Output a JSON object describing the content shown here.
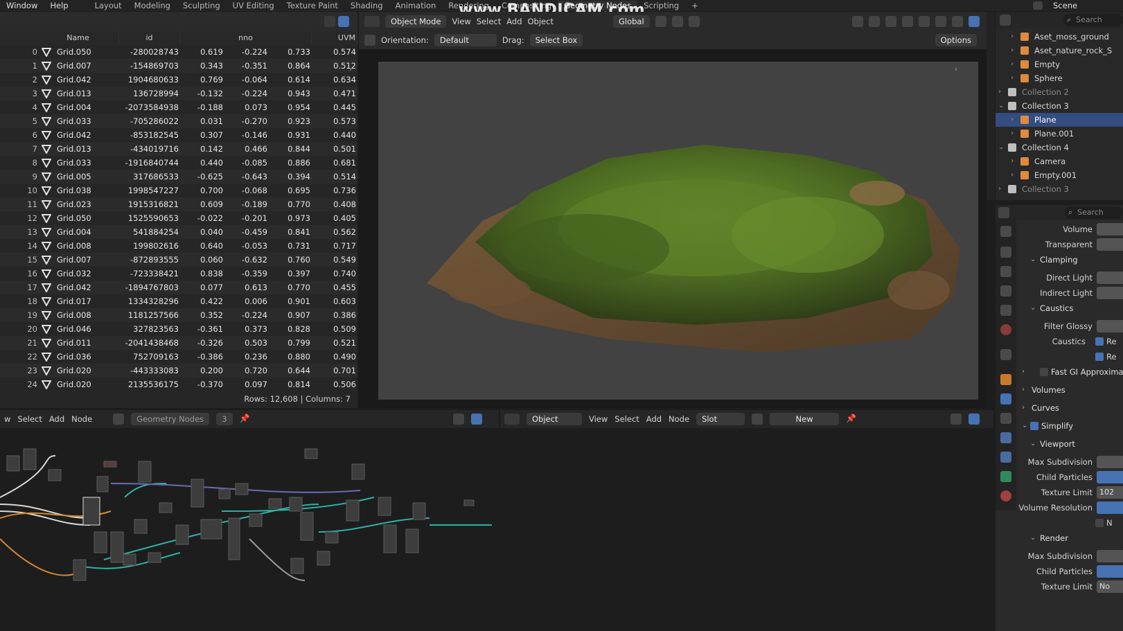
{
  "menu": [
    "Window",
    "Help"
  ],
  "workspaces": [
    {
      "label": "Layout",
      "active": false
    },
    {
      "label": "Modeling",
      "active": false
    },
    {
      "label": "Sculpting",
      "active": false
    },
    {
      "label": "UV Editing",
      "active": false
    },
    {
      "label": "Texture Paint",
      "active": false
    },
    {
      "label": "Shading",
      "active": false
    },
    {
      "label": "Animation",
      "active": false
    },
    {
      "label": "Rendering",
      "active": false
    },
    {
      "label": "Compositing",
      "active": false
    },
    {
      "label": "Geometry Nodes",
      "active": true
    },
    {
      "label": "Scripting",
      "active": false
    }
  ],
  "add_workspace": "+",
  "watermark": "www.BANDICAM.com",
  "scene_label": "Scene",
  "spreadsheet": {
    "columns": [
      "Name",
      "id",
      "nno",
      "UVM"
    ],
    "rows": [
      [
        "0",
        "Grid.050",
        "-280028743",
        "0.619",
        "-0.224",
        "0.733",
        "0.574"
      ],
      [
        "1",
        "Grid.007",
        "-154869703",
        "0.343",
        "-0.351",
        "0.864",
        "0.512"
      ],
      [
        "2",
        "Grid.042",
        "1904680633",
        "0.769",
        "-0.064",
        "0.614",
        "0.634"
      ],
      [
        "3",
        "Grid.013",
        "136728994",
        "-0.132",
        "-0.224",
        "0.943",
        "0.471"
      ],
      [
        "4",
        "Grid.004",
        "-2073584938",
        "-0.188",
        "0.073",
        "0.954",
        "0.445"
      ],
      [
        "5",
        "Grid.033",
        "-705286022",
        "0.031",
        "-0.270",
        "0.923",
        "0.573"
      ],
      [
        "6",
        "Grid.042",
        "-853182545",
        "0.307",
        "-0.146",
        "0.931",
        "0.440"
      ],
      [
        "7",
        "Grid.013",
        "-434019716",
        "0.142",
        "0.466",
        "0.844",
        "0.501"
      ],
      [
        "8",
        "Grid.033",
        "-1916840744",
        "0.440",
        "-0.085",
        "0.886",
        "0.681"
      ],
      [
        "9",
        "Grid.005",
        "317686533",
        "-0.625",
        "-0.643",
        "0.394",
        "0.514"
      ],
      [
        "10",
        "Grid.038",
        "1998547227",
        "0.700",
        "-0.068",
        "0.695",
        "0.736"
      ],
      [
        "11",
        "Grid.023",
        "1915316821",
        "0.609",
        "-0.189",
        "0.770",
        "0.408"
      ],
      [
        "12",
        "Grid.050",
        "1525590653",
        "-0.022",
        "-0.201",
        "0.973",
        "0.405"
      ],
      [
        "13",
        "Grid.004",
        "541884254",
        "0.040",
        "-0.459",
        "0.841",
        "0.562"
      ],
      [
        "14",
        "Grid.008",
        "199802616",
        "0.640",
        "-0.053",
        "0.731",
        "0.717"
      ],
      [
        "15",
        "Grid.007",
        "-872893555",
        "0.060",
        "-0.632",
        "0.760",
        "0.549"
      ],
      [
        "16",
        "Grid.032",
        "-723338421",
        "0.838",
        "-0.359",
        "0.397",
        "0.740"
      ],
      [
        "17",
        "Grid.042",
        "-1894767803",
        "0.077",
        "0.613",
        "0.770",
        "0.455"
      ],
      [
        "18",
        "Grid.017",
        "1334328296",
        "0.422",
        "0.006",
        "0.901",
        "0.603"
      ],
      [
        "19",
        "Grid.008",
        "1181257566",
        "0.352",
        "-0.224",
        "0.907",
        "0.386"
      ],
      [
        "20",
        "Grid.046",
        "327823563",
        "-0.361",
        "0.373",
        "0.828",
        "0.509"
      ],
      [
        "21",
        "Grid.011",
        "-2041438468",
        "-0.326",
        "0.503",
        "0.799",
        "0.521"
      ],
      [
        "22",
        "Grid.036",
        "752709163",
        "-0.386",
        "0.236",
        "0.880",
        "0.490"
      ],
      [
        "23",
        "Grid.020",
        "-443333083",
        "0.200",
        "0.720",
        "0.644",
        "0.701"
      ],
      [
        "24",
        "Grid.020",
        "2135536175",
        "-0.370",
        "0.097",
        "0.814",
        "0.506"
      ]
    ],
    "footer": "Rows: 12,608   |   Columns: 7"
  },
  "viewport": {
    "mode": "Object Mode",
    "menus": [
      "View",
      "Select",
      "Add",
      "Object"
    ],
    "transform": "Global",
    "orientation_label": "Orientation:",
    "orientation_value": "Default",
    "drag_label": "Drag:",
    "drag_value": "Select Box",
    "options": "Options"
  },
  "outliner": {
    "search_placeholder": "Search",
    "items": [
      {
        "label": "Aset_moss_ground",
        "indent": 2,
        "icon": "mesh-icon",
        "selected": false
      },
      {
        "label": "Aset_nature_rock_S",
        "indent": 2,
        "icon": "mesh-icon",
        "selected": false
      },
      {
        "label": "Empty",
        "indent": 2,
        "icon": "empty-icon",
        "selected": false
      },
      {
        "label": "Sphere",
        "indent": 2,
        "icon": "mesh-icon",
        "selected": false
      },
      {
        "label": "Collection 2",
        "indent": 1,
        "icon": "collection-icon",
        "selected": false
      },
      {
        "label": "Collection 3",
        "indent": 1,
        "icon": "collection-icon",
        "selected": false
      },
      {
        "label": "Plane",
        "indent": 2,
        "icon": "mesh-icon",
        "selected": true
      },
      {
        "label": "Plane.001",
        "indent": 2,
        "icon": "mesh-icon",
        "selected": false
      },
      {
        "label": "Collection 4",
        "indent": 1,
        "icon": "collection-icon",
        "selected": false
      },
      {
        "label": "Camera",
        "indent": 2,
        "icon": "camera-icon",
        "selected": false
      },
      {
        "label": "Empty.001",
        "indent": 2,
        "icon": "empty-icon",
        "selected": false
      },
      {
        "label": "Collection 3",
        "indent": 1,
        "icon": "collection-icon",
        "selected": false
      }
    ]
  },
  "properties": {
    "search_placeholder": "Search",
    "rows": [
      {
        "type": "field",
        "label": "Volume"
      },
      {
        "type": "field",
        "label": "Transparent"
      },
      {
        "type": "section",
        "label": "Clamping"
      },
      {
        "type": "field",
        "label": "Direct Light"
      },
      {
        "type": "field",
        "label": "Indirect Light"
      },
      {
        "type": "section",
        "label": "Caustics"
      },
      {
        "type": "field",
        "label": "Filter Glossy"
      },
      {
        "type": "check",
        "label": "Caustics",
        "value": "Re"
      },
      {
        "type": "check",
        "label": "",
        "value": "Re"
      },
      {
        "type": "section",
        "label": "Fast GI Approxima"
      },
      {
        "type": "section",
        "label": "Volumes"
      },
      {
        "type": "section",
        "label": "Curves"
      },
      {
        "type": "section",
        "label": "Simplify"
      },
      {
        "type": "section",
        "label": "Viewport"
      },
      {
        "type": "field",
        "label": "Max Subdivision"
      },
      {
        "type": "fieldblue",
        "label": "Child Particles"
      },
      {
        "type": "field",
        "label": "Texture Limit",
        "value": "102"
      },
      {
        "type": "fieldblue",
        "label": "Volume Resolution"
      },
      {
        "type": "check",
        "label": "",
        "value": "N"
      },
      {
        "type": "section",
        "label": "Render"
      },
      {
        "type": "field",
        "label": "Max Subdivision"
      },
      {
        "type": "fieldblue",
        "label": "Child Particles"
      },
      {
        "type": "field",
        "label": "Texture Limit",
        "value": "No"
      }
    ]
  },
  "node_left": {
    "menus": [
      "w",
      "Select",
      "Add",
      "Node"
    ],
    "tree_name": "Geometry Nodes",
    "users": "3"
  },
  "node_right": {
    "object_label": "Object",
    "menus": [
      "View",
      "Select",
      "Add",
      "Node"
    ],
    "slot": "Slot",
    "new_button": "New"
  },
  "colors": {
    "selection": "#334d80",
    "accent_blue": "#4772b3",
    "wire_teal": "#2bb3a7",
    "wire_orange": "#d68a2e"
  }
}
